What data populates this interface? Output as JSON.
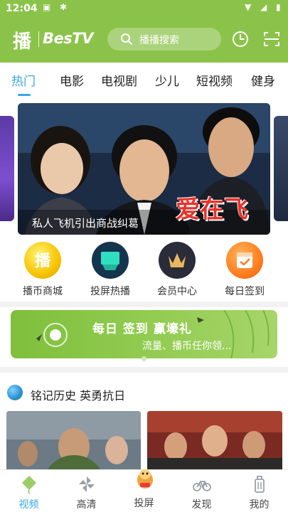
{
  "status": {
    "time": "12:04"
  },
  "header": {
    "logo_char": "播",
    "logo_text": "BesTV",
    "search_placeholder": "播播搜索"
  },
  "tabs": [
    {
      "label": "热门",
      "active": true
    },
    {
      "label": "电影",
      "active": false
    },
    {
      "label": "电视剧",
      "active": false
    },
    {
      "label": "少儿",
      "active": false
    },
    {
      "label": "短视频",
      "active": false
    },
    {
      "label": "健身",
      "active": false
    }
  ],
  "banner": {
    "caption": "私人飞机引出商战纠葛",
    "title_art": "爱在飞"
  },
  "quick_entries": [
    {
      "label": "播币商城",
      "icon": "coin-icon"
    },
    {
      "label": "投屏热播",
      "icon": "cast-screen-icon"
    },
    {
      "label": "会员中心",
      "icon": "member-crown-icon"
    },
    {
      "label": "每日签到",
      "icon": "calendar-checkin-icon"
    }
  ],
  "signin_banner": {
    "headline": "每日 签到 赢壕礼",
    "subline": "流量、播币任你领..."
  },
  "section": {
    "title": "铭记历史 英勇抗日"
  },
  "bottom_nav": [
    {
      "label": "视频",
      "icon": "video-kite-icon",
      "active": true
    },
    {
      "label": "高清",
      "icon": "pinwheel-icon",
      "active": false
    },
    {
      "label": "投屏",
      "icon": "cast-mascot-icon",
      "active": false
    },
    {
      "label": "发现",
      "icon": "bicycle-icon",
      "active": false
    },
    {
      "label": "我的",
      "icon": "luggage-icon",
      "active": false
    }
  ],
  "colors": {
    "brand_green": "#8bc34a",
    "active_blue": "#3aa7e0"
  }
}
